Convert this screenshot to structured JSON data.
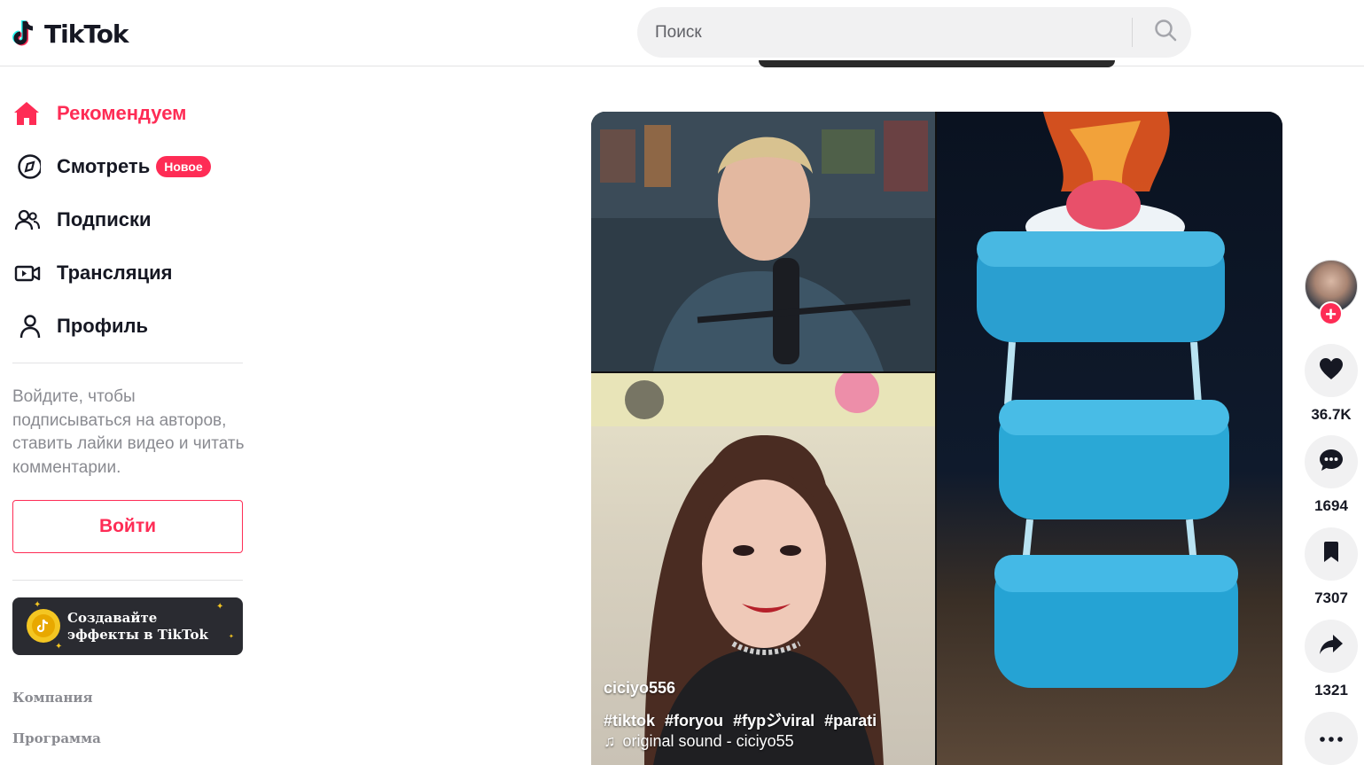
{
  "header": {
    "logo_text": "TikTok",
    "search": {
      "placeholder": "Поиск",
      "value": ""
    }
  },
  "sidebar": {
    "nav": [
      {
        "label": "Рекомендуем",
        "icon": "home-icon",
        "active": true
      },
      {
        "label": "Смотреть",
        "icon": "compass-icon",
        "badge": "Новое"
      },
      {
        "label": "Подписки",
        "icon": "users-icon"
      },
      {
        "label": "Трансляция",
        "icon": "live-icon"
      },
      {
        "label": "Профиль",
        "icon": "profile-icon"
      }
    ],
    "login_prompt": "Войдите, чтобы подписываться на авторов, ставить лайки видео и читать комментарии.",
    "login_button": "Войти",
    "effects_banner": "Создавайте эффекты в TikTok",
    "footer_links": [
      "Компания",
      "Программа"
    ]
  },
  "video": {
    "author": "ciciyo556",
    "hashtags": [
      "#tiktok",
      "#foryou",
      "#fypジviral",
      "#parati"
    ],
    "sound": "original sound - ciciyo55"
  },
  "actions": {
    "likes": "36.7K",
    "comments": "1694",
    "saves": "7307",
    "shares": "1321"
  },
  "colors": {
    "accent": "#fe2c55",
    "text": "#161823",
    "muted": "#8a8b91"
  }
}
